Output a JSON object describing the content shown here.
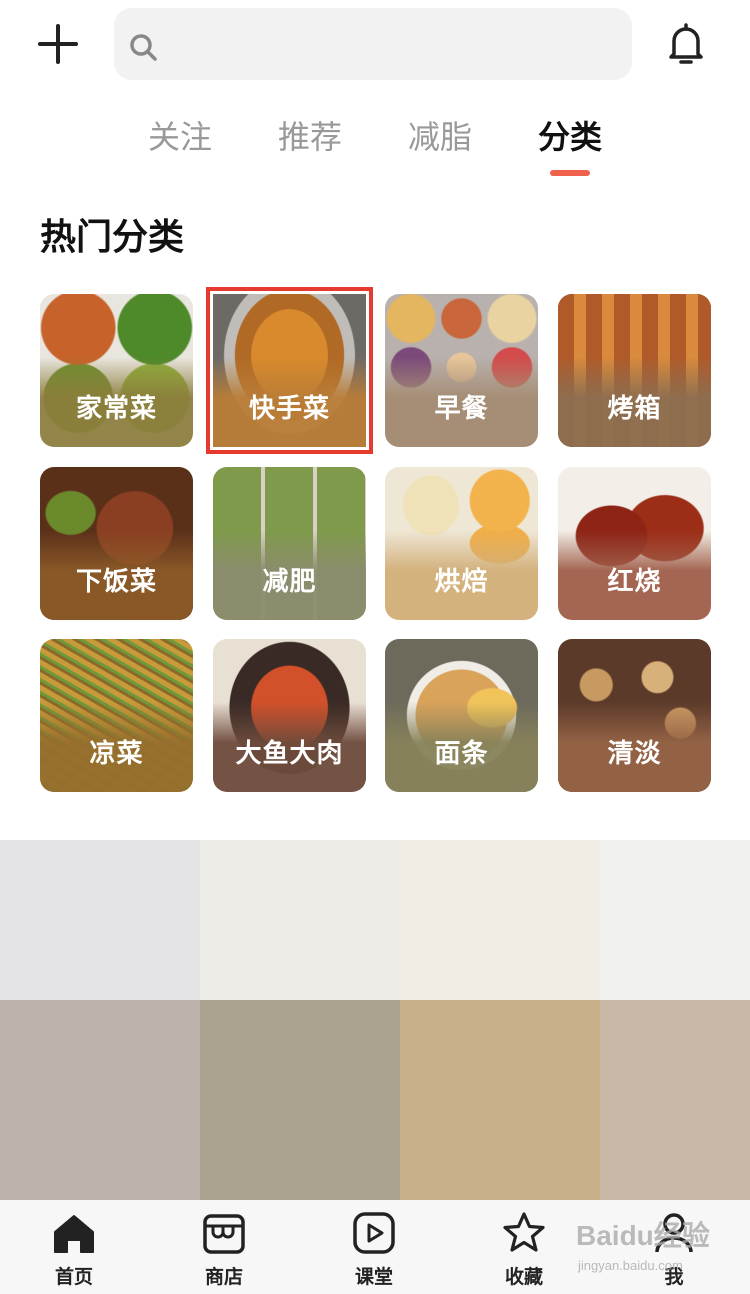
{
  "search": {
    "placeholder": "",
    "value": ""
  },
  "tabs": [
    {
      "label": "关注",
      "active": false
    },
    {
      "label": "推荐",
      "active": false
    },
    {
      "label": "减脂",
      "active": false
    },
    {
      "label": "分类",
      "active": true
    }
  ],
  "section": {
    "title": "热门分类"
  },
  "categories": [
    {
      "label": "家常菜"
    },
    {
      "label": "快手菜",
      "selected": true
    },
    {
      "label": "早餐"
    },
    {
      "label": "烤箱"
    },
    {
      "label": "下饭菜"
    },
    {
      "label": "减肥"
    },
    {
      "label": "烘焙"
    },
    {
      "label": "红烧"
    },
    {
      "label": "凉菜"
    },
    {
      "label": "大鱼大肉"
    },
    {
      "label": "面条"
    },
    {
      "label": "清淡"
    }
  ],
  "palette": {
    "top_row": [
      "#e4e4e6",
      "#edece6",
      "#f1ede4",
      "#f1f1ef"
    ],
    "bottom_row": [
      "#bdb1ac",
      "#a9a38f",
      "#c8b088",
      "#c7b8a7"
    ]
  },
  "bottom_nav": [
    {
      "label": "首页",
      "icon": "home-icon"
    },
    {
      "label": "商店",
      "icon": "shop-icon"
    },
    {
      "label": "课堂",
      "icon": "play-icon"
    },
    {
      "label": "收藏",
      "icon": "star-icon"
    },
    {
      "label": "我",
      "icon": "user-icon"
    }
  ],
  "watermark": {
    "text": "Baidu经验",
    "sub": "jingyan.baidu.com"
  },
  "colors": {
    "accent": "#f0614d",
    "highlight": "#e63a2e"
  }
}
